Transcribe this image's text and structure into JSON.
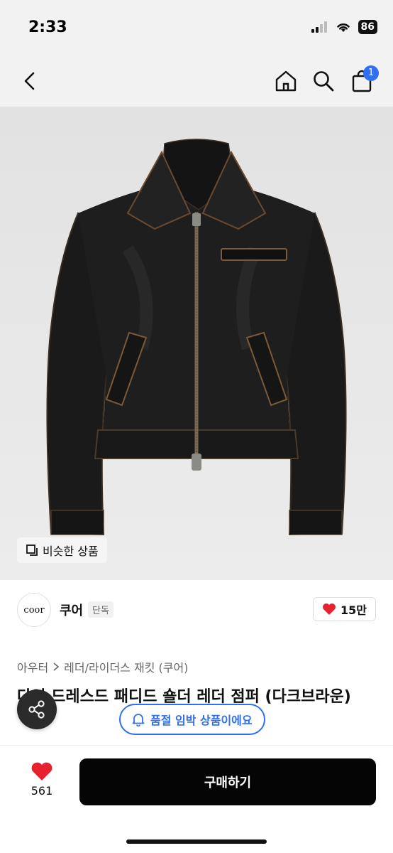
{
  "status": {
    "time": "2:33",
    "battery": "86"
  },
  "nav": {
    "cart_count": "1"
  },
  "product_image": {
    "similar_label": "비슷한 상품"
  },
  "brand": {
    "logo_text": "coor",
    "name": "쿠어",
    "tag": "단독",
    "likes": "15만"
  },
  "category": {
    "primary": "아우터",
    "secondary": "레더/라이더스 재킷 (쿠어)"
  },
  "title": "다잉 드레스드 패디드 숄더 레더 점퍼 (다크브라운)",
  "stock_notice": "품절 임박 상품이에요",
  "bottom": {
    "wish_count": "561",
    "buy_label": "구매하기"
  },
  "colors": {
    "accent": "#2f6ff0",
    "heart": "#e8212e",
    "buy_button": "#050505"
  }
}
